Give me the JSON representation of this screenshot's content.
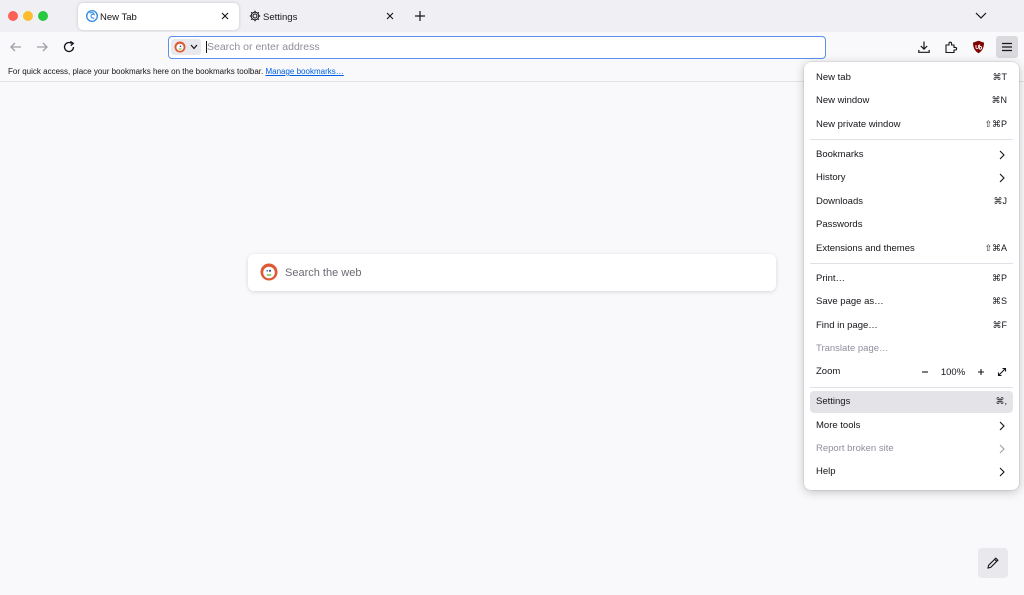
{
  "tabs": [
    {
      "label": "New Tab",
      "icon": "firefox-icon",
      "active": true
    },
    {
      "label": "Settings",
      "icon": "gear-icon",
      "active": false
    }
  ],
  "urlbar": {
    "placeholder": "Search or enter address"
  },
  "bookmarks_bar": {
    "text": "For quick access, place your bookmarks here on the bookmarks toolbar.",
    "link": "Manage bookmarks…"
  },
  "search": {
    "placeholder": "Search the web"
  },
  "menu": {
    "new_tab": {
      "label": "New tab",
      "shortcut": "⌘T"
    },
    "new_window": {
      "label": "New window",
      "shortcut": "⌘N"
    },
    "new_private_window": {
      "label": "New private window",
      "shortcut": "⇧⌘P"
    },
    "bookmarks": {
      "label": "Bookmarks"
    },
    "history": {
      "label": "History"
    },
    "downloads": {
      "label": "Downloads",
      "shortcut": "⌘J"
    },
    "passwords": {
      "label": "Passwords"
    },
    "extensions": {
      "label": "Extensions and themes",
      "shortcut": "⇧⌘A"
    },
    "print": {
      "label": "Print…",
      "shortcut": "⌘P"
    },
    "save_page": {
      "label": "Save page as…",
      "shortcut": "⌘S"
    },
    "find": {
      "label": "Find in page…",
      "shortcut": "⌘F"
    },
    "translate": {
      "label": "Translate page…"
    },
    "zoom": {
      "label": "Zoom",
      "value": "100%"
    },
    "settings": {
      "label": "Settings",
      "shortcut": "⌘,"
    },
    "more_tools": {
      "label": "More tools"
    },
    "report": {
      "label": "Report broken site"
    },
    "help": {
      "label": "Help"
    }
  },
  "colors": {
    "accent": "#5b90ec",
    "link": "#0061e0",
    "ublock": "#800000"
  }
}
